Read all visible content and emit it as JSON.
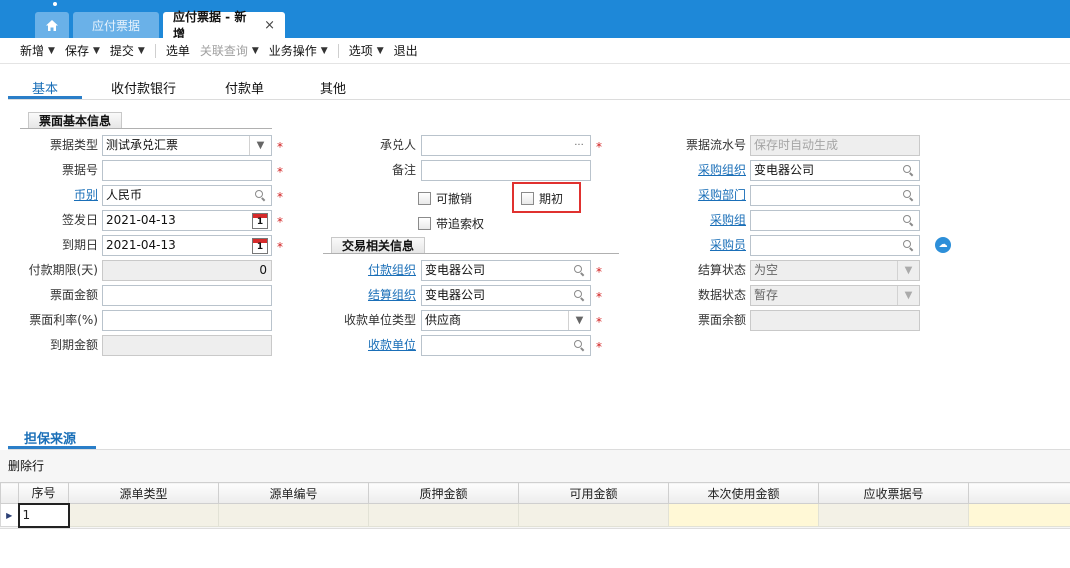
{
  "tabs": {
    "inactive_label": "应付票据",
    "active_label": "应付票据 - 新增",
    "close_glyph": "×"
  },
  "toolbar": {
    "items": [
      {
        "label": "新增",
        "menu": true
      },
      {
        "label": "保存",
        "menu": true
      },
      {
        "label": "提交",
        "menu": true
      },
      {
        "label": "选单",
        "menu": false
      },
      {
        "label": "关联查询",
        "menu": true,
        "disabled": true
      },
      {
        "label": "业务操作",
        "menu": true
      },
      {
        "label": "选项",
        "menu": true
      },
      {
        "label": "退出",
        "menu": false
      }
    ]
  },
  "content_tabs": [
    "基本",
    "收付款银行",
    "付款单",
    "其他"
  ],
  "sections": {
    "basic": "票面基本信息",
    "trade": "交易相关信息"
  },
  "left": {
    "bill_type": {
      "label": "票据类型",
      "value": "测试承兑汇票"
    },
    "bill_no": {
      "label": "票据号",
      "value": ""
    },
    "currency": {
      "label": "币别",
      "value": "人民币"
    },
    "issue_date": {
      "label": "签发日",
      "value": "2021-04-13"
    },
    "due_date": {
      "label": "到期日",
      "value": "2021-04-13"
    },
    "pay_term": {
      "label": "付款期限(天)",
      "value": "0"
    },
    "face_amount": {
      "label": "票面金额",
      "value": ""
    },
    "face_rate": {
      "label": "票面利率(%)",
      "value": ""
    },
    "due_amount": {
      "label": "到期金额",
      "value": ""
    },
    "calendar_day": "1"
  },
  "middle": {
    "acceptor": {
      "label": "承兑人",
      "value": "",
      "btn": "···"
    },
    "remark": {
      "label": "备注",
      "value": ""
    },
    "revocable": "可撤销",
    "initial": "期初",
    "recourse": "带追索权",
    "pay_org": {
      "label": "付款组织",
      "value": "变电器公司"
    },
    "settle_org": {
      "label": "结算组织",
      "value": "变电器公司"
    },
    "payee_type": {
      "label": "收款单位类型",
      "value": "供应商"
    },
    "payee": {
      "label": "收款单位",
      "value": ""
    }
  },
  "right": {
    "serial_no": {
      "label": "票据流水号",
      "placeholder": "保存时自动生成"
    },
    "purchase_org": {
      "label": "采购组织",
      "value": "变电器公司"
    },
    "purchase_dept": {
      "label": "采购部门",
      "value": ""
    },
    "purchase_group": {
      "label": "采购组",
      "value": ""
    },
    "purchaser": {
      "label": "采购员",
      "value": ""
    },
    "settle_status": {
      "label": "结算状态",
      "value": "为空"
    },
    "data_status": {
      "label": "数据状态",
      "value": "暂存"
    },
    "face_balance": {
      "label": "票面余额",
      "value": ""
    }
  },
  "guarantee": {
    "tab_label": "担保来源",
    "delete_row": "删除行",
    "columns": [
      "序号",
      "源单类型",
      "源单编号",
      "质押金额",
      "可用金额",
      "本次使用金额",
      "应收票据号"
    ],
    "rows": [
      {
        "seq": "1"
      }
    ]
  },
  "required_mark": "*",
  "colors": {
    "accent": "#1e88d8",
    "link": "#1a6fb8",
    "required": "#d11c1c",
    "highlight": "#e0312f"
  }
}
